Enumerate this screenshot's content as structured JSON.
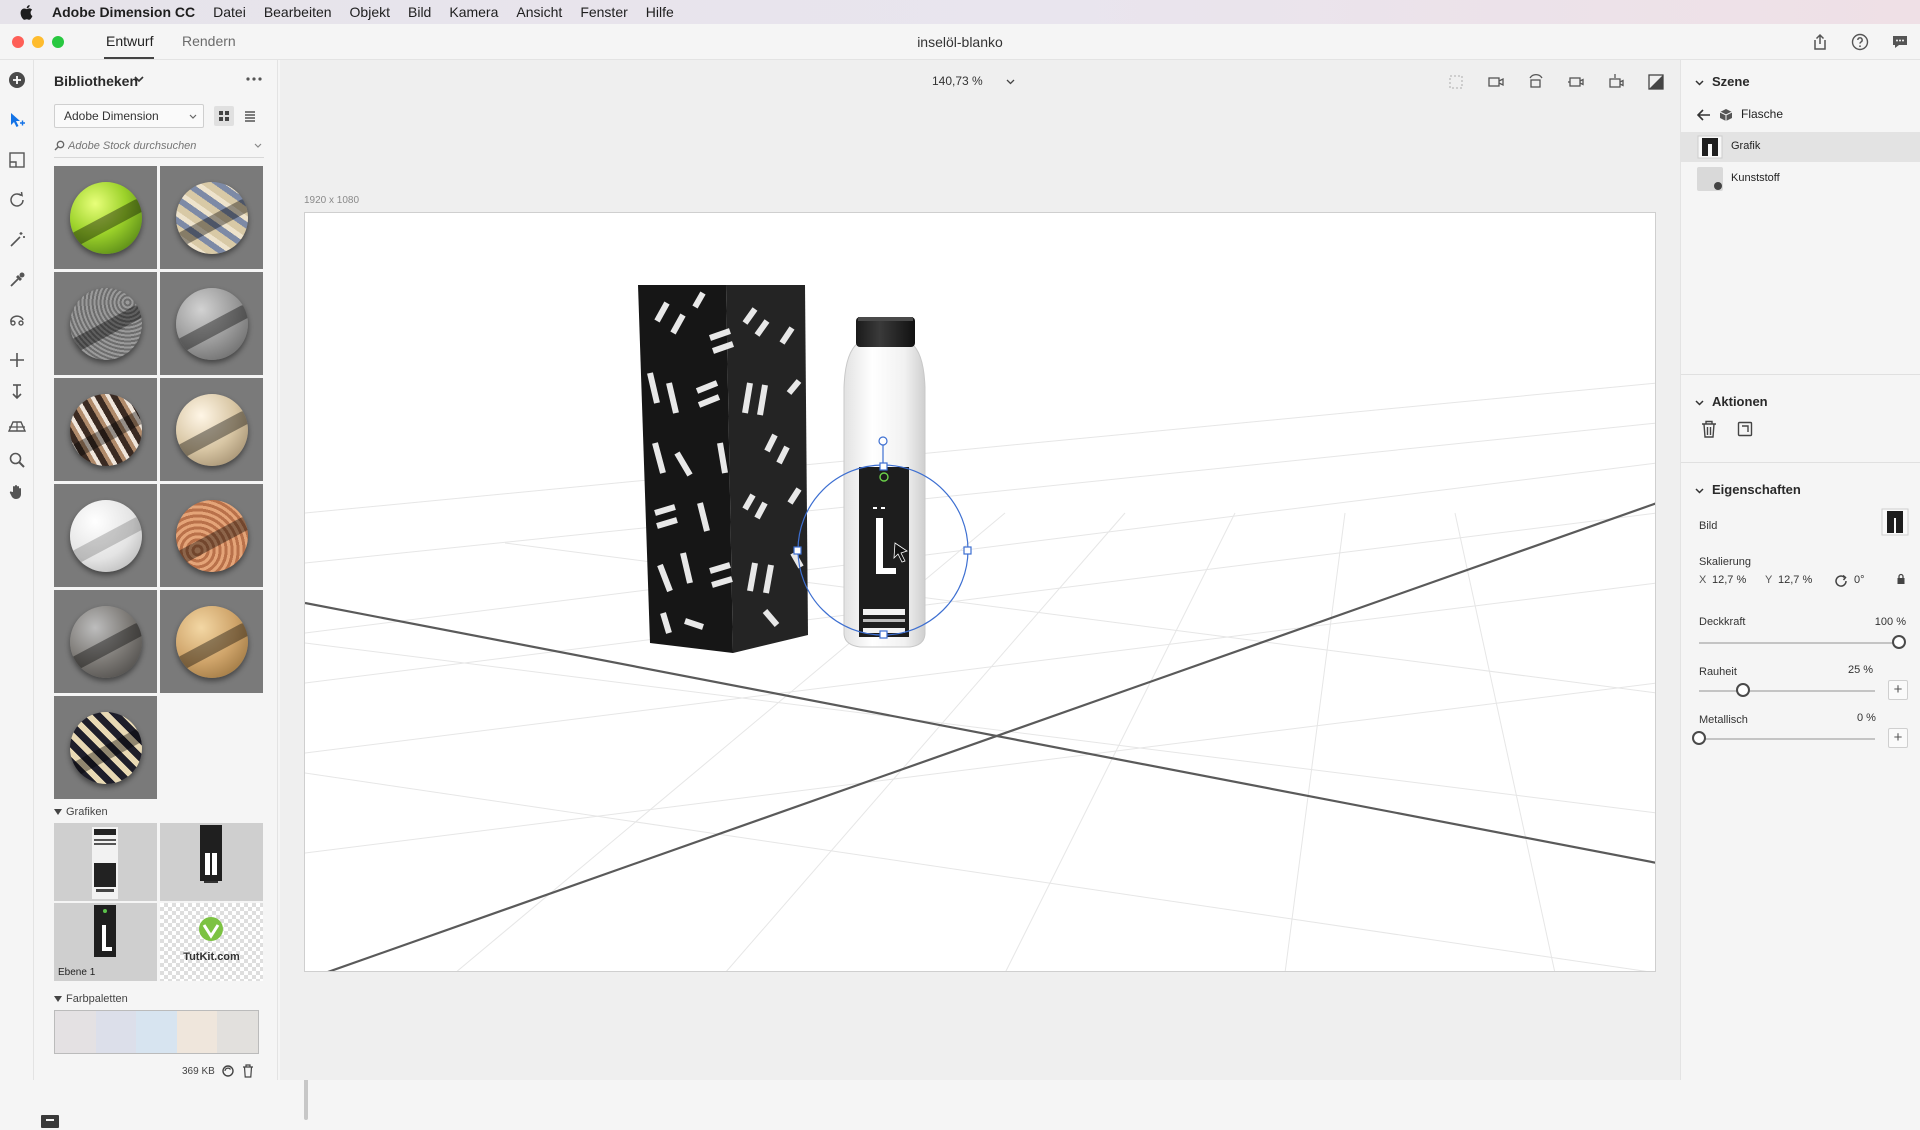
{
  "menubar": {
    "app_name": "Adobe Dimension CC",
    "items": [
      "Datei",
      "Bearbeiten",
      "Objekt",
      "Bild",
      "Kamera",
      "Ansicht",
      "Fenster",
      "Hilfe"
    ]
  },
  "titlebar": {
    "tab_design": "Entwurf",
    "tab_render": "Rendern",
    "document_title": "inselöl-blanko"
  },
  "library": {
    "title": "Bibliotheken",
    "source_select": "Adobe Dimension",
    "search_placeholder": "Adobe Stock durchsuchen",
    "graphics_section": "Grafiken",
    "graphics_tile_label": "Ebene 1",
    "tutkit_label": "TutKit.com",
    "palettes_section": "Farbpaletten",
    "storage_size": "369 KB",
    "palette_colors": [
      "#e4e1e3",
      "#dcdfea",
      "#d7e4f0",
      "#efe6dc",
      "#e2e0dd"
    ]
  },
  "canvas": {
    "zoom": "140,73 %",
    "size_label": "1920 x 1080"
  },
  "scene": {
    "title": "Szene",
    "breadcrumb": "Flasche",
    "layers": [
      "Grafik",
      "Kunststoff"
    ]
  },
  "actions": {
    "title": "Aktionen"
  },
  "properties": {
    "title": "Eigenschaften",
    "image_label": "Bild",
    "scaling_label": "Skalierung",
    "scale_x_label": "X",
    "scale_x": "12,7 %",
    "scale_y_label": "Y",
    "scale_y": "12,7 %",
    "rotation": "0°",
    "opacity_label": "Deckkraft",
    "opacity_value": "100 %",
    "opacity_fraction": 1.0,
    "roughness_label": "Rauheit",
    "roughness_value": "25 %",
    "roughness_fraction": 0.25,
    "metallic_label": "Metallisch",
    "metallic_value": "0 %",
    "metallic_fraction": 0.0
  }
}
